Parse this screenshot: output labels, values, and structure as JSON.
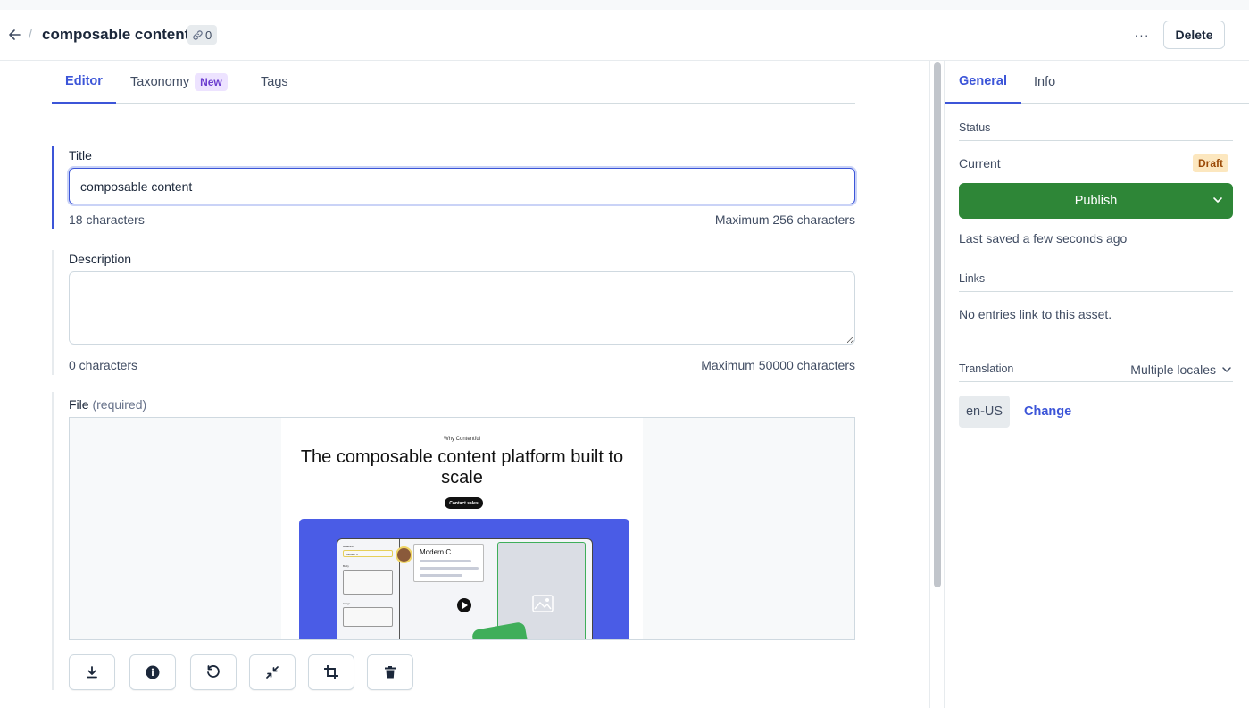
{
  "header": {
    "title": "composable content",
    "reference_count": "0",
    "more_label": "···",
    "delete_label": "Delete"
  },
  "editor_tabs": [
    {
      "label": "Editor",
      "active": true
    },
    {
      "label": "Taxonomy",
      "badge": "New",
      "active": false
    },
    {
      "label": "Tags",
      "active": false
    }
  ],
  "fields": {
    "title": {
      "label": "Title",
      "value": "composable content",
      "char_count": "18 characters",
      "max_hint": "Maximum 256 characters"
    },
    "description": {
      "label": "Description",
      "value": "",
      "char_count": "0 characters",
      "max_hint": "Maximum 50000 characters"
    },
    "file": {
      "label": "File",
      "required_label": "(required)",
      "preview": {
        "kicker": "Why Contentful",
        "headline": "The composable content platform built to scale",
        "cta": "Contact sales",
        "card_title": "Modern C",
        "field_labels": [
          "Headline",
          "Modern C",
          "Body",
          "Image"
        ]
      },
      "toolbar_icons": [
        "download-icon",
        "info-icon",
        "rotate-icon",
        "shrink-icon",
        "crop-icon",
        "trash-icon"
      ]
    }
  },
  "sidebar": {
    "tabs": [
      {
        "label": "General",
        "active": true
      },
      {
        "label": "Info",
        "active": false
      }
    ],
    "status": {
      "heading": "Status",
      "current_label": "Current",
      "badge": "Draft",
      "publish_label": "Publish",
      "last_saved": "Last saved a few seconds ago"
    },
    "links": {
      "heading": "Links",
      "text": "No entries link to this asset."
    },
    "translation": {
      "heading": "Translation",
      "selector": "Multiple locales",
      "locale": "en-US",
      "change_label": "Change"
    }
  },
  "colors": {
    "accent": "#3c55d8",
    "publish": "#2e8637",
    "draft_bg": "#fce7bf",
    "draft_text": "#9b4a07",
    "new_badge_bg": "#ede3ff",
    "new_badge_text": "#6c3ecf"
  }
}
